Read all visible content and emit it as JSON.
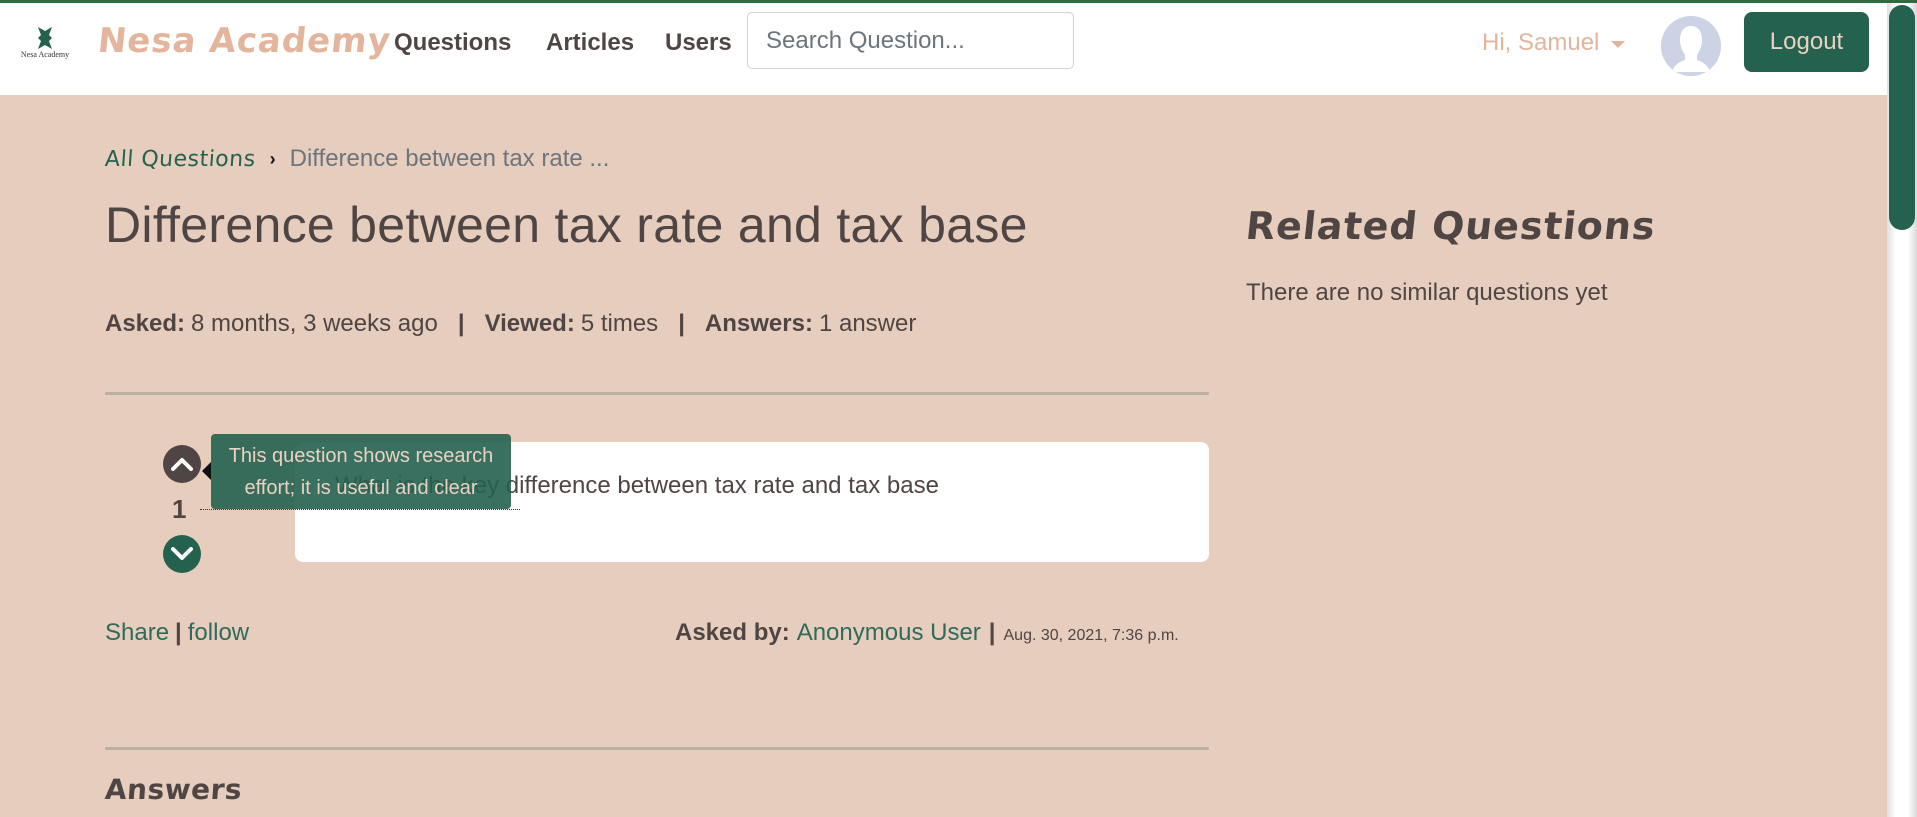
{
  "header": {
    "logo_caption": "Nesa Academy",
    "brand": "Nesa Academy",
    "nav": [
      {
        "label": "Questions"
      },
      {
        "label": "Articles"
      },
      {
        "label": "Users"
      }
    ],
    "search_placeholder": "Search Question...",
    "greeting": "Hi, Samuel",
    "logout_label": "Logout"
  },
  "breadcrumb": {
    "root": "All Questions",
    "separator": "›",
    "current": "Difference between tax rate ..."
  },
  "question": {
    "title": "Difference between tax rate and tax base",
    "meta": {
      "asked_label": "Asked:",
      "asked_value": "8 months, 3 weeks ago",
      "viewed_label": "Viewed:",
      "viewed_value": "5 times",
      "answers_label": "Answers:",
      "answers_value": "1 answer",
      "separator": "|"
    },
    "votes": 1,
    "body": "What is the key difference between tax rate and tax base",
    "tooltip": "This question shows research effort; it is useful and clear",
    "share_label": "Share",
    "follow_label": "follow",
    "separator": "|",
    "asked_by_label": "Asked by:",
    "author": "Anonymous User",
    "date": "Aug. 30, 2021, 7:36 p.m."
  },
  "answers_heading": "Answers",
  "related": {
    "title": "Related Questions",
    "empty_message": "There are no similar questions yet"
  },
  "colors": {
    "background": "#e7cdbd",
    "primary_green": "#24614f",
    "brand_peach": "#e2b59c",
    "text_dark": "#4f4544",
    "link_green": "#2f6a5c"
  }
}
